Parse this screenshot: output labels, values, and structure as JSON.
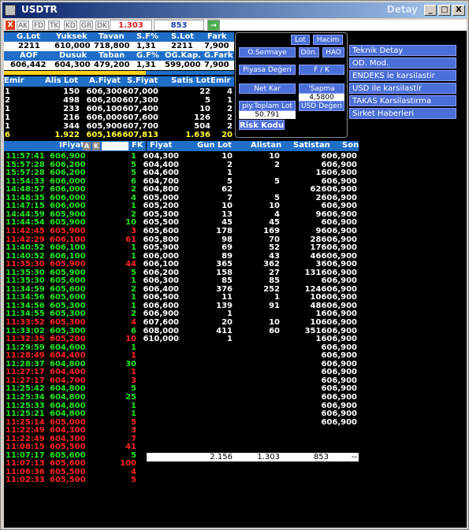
{
  "window": {
    "title": "USDTR",
    "right_title": "Detay",
    "min_label": "_",
    "max_label": "□",
    "close_label": "X"
  },
  "toolbar": {
    "close_label": "X",
    "tabs": [
      "AK",
      "FD",
      "TK",
      "KD",
      "GR",
      "DK"
    ],
    "price_red": "1.303",
    "price_blue": "853",
    "go_label": "→"
  },
  "summary": {
    "headers1": [
      "G.Lot",
      "Yuksek",
      "Tavan",
      "S.F%",
      "S.Lot",
      "Fark"
    ],
    "values1": [
      "2211",
      "610,000",
      "718,800",
      "1,31",
      "2211",
      "7,900"
    ],
    "headers2": [
      "AOF",
      "Dusuk",
      "Taban",
      "G.F%",
      "OG.Kap.",
      "G.Fark"
    ],
    "values2": [
      "606,442",
      "604,300",
      "479,200",
      "1,31",
      "599,000",
      "7,900"
    ]
  },
  "depth": {
    "headers": [
      "Emir",
      "Alis Lot",
      "A.Fiyat",
      "S.Fiyat",
      "Satis Lot",
      "Emir"
    ],
    "rows": [
      [
        "1",
        "150",
        "606,300",
        "607,000",
        "22",
        "4"
      ],
      [
        "2",
        "498",
        "606,200",
        "607,300",
        "5",
        "1"
      ],
      [
        "1",
        "233",
        "606,100",
        "607,400",
        "10",
        "2"
      ],
      [
        "1",
        "216",
        "606,000",
        "607,600",
        "126",
        "2"
      ],
      [
        "1",
        "344",
        "605,900",
        "607,700",
        "504",
        "2"
      ]
    ],
    "total": [
      "16",
      "1.922",
      "605,166",
      "607,813",
      "1.636",
      "20"
    ]
  },
  "panel": {
    "lot_label": "Lot",
    "hacim_label": "Hacim",
    "osermaye_label": "O.Sermaye",
    "don_label": "Dön.",
    "hao_label": "HAO",
    "piyasa_label": "Piyasa Değeri",
    "fk_label": "F / K",
    "netkar_label": "Net Kar",
    "sapma_label": "'Sapma",
    "sapma_value": "4,5800",
    "piy_toplam_label": "piy.Toplam Lot",
    "usd_degeri_label": "USD Değeri",
    "piy_toplam_value": "50.791",
    "risk_label": "Risk Kodu"
  },
  "side_menu": [
    "Teknik Detay",
    "OD. Mod.",
    "ENDEKS le karsilastir",
    "USD ile karsilastir",
    "TAKAS Karsilastirma",
    "Sirket Haberleri"
  ],
  "trades": {
    "header_time": "",
    "header_price": "IFiyat",
    "header_a": "A",
    "header_k": "K",
    "header_fk": "FK",
    "rows": [
      {
        "time": "11:57:41",
        "price": "606,900",
        "lot": "1",
        "side": "buy"
      },
      {
        "time": "15:57:28",
        "price": "606,200",
        "lot": "5",
        "side": "buy"
      },
      {
        "time": "15:57:28",
        "price": "606,200",
        "lot": "5",
        "side": "buy"
      },
      {
        "time": "11:54:33",
        "price": "606,000",
        "lot": "6",
        "side": "buy"
      },
      {
        "time": "14:48:57",
        "price": "606,000",
        "lot": "2",
        "side": "buy"
      },
      {
        "time": "11:48:35",
        "price": "606,000",
        "lot": "4",
        "side": "buy"
      },
      {
        "time": "11:47:15",
        "price": "606,000",
        "lot": "1",
        "side": "buy"
      },
      {
        "time": "14:44:59",
        "price": "605,900",
        "lot": "2",
        "side": "buy"
      },
      {
        "time": "11:44:54",
        "price": "605,900",
        "lot": "10",
        "side": "buy"
      },
      {
        "time": "11:42:45",
        "price": "605,900",
        "lot": "3",
        "side": "sell"
      },
      {
        "time": "11:42:29",
        "price": "606,100",
        "lot": "61",
        "side": "sell"
      },
      {
        "time": "11:40:52",
        "price": "606,100",
        "lot": "1",
        "side": "buy"
      },
      {
        "time": "11:40:52",
        "price": "606,100",
        "lot": "1",
        "side": "buy"
      },
      {
        "time": "11:35:30",
        "price": "605,900",
        "lot": "44",
        "side": "sell"
      },
      {
        "time": "11:35:30",
        "price": "605,900",
        "lot": "5",
        "side": "buy"
      },
      {
        "time": "11:35:30",
        "price": "605,600",
        "lot": "1",
        "side": "buy"
      },
      {
        "time": "11:34:59",
        "price": "605,600",
        "lot": "2",
        "side": "buy"
      },
      {
        "time": "11:34:56",
        "price": "605,600",
        "lot": "1",
        "side": "buy"
      },
      {
        "time": "11:34:56",
        "price": "605,300",
        "lot": "1",
        "side": "buy"
      },
      {
        "time": "11:34:55",
        "price": "605,300",
        "lot": "2",
        "side": "buy"
      },
      {
        "time": "11:33:52",
        "price": "605,300",
        "lot": "4",
        "side": "sell"
      },
      {
        "time": "11:33:02",
        "price": "605,300",
        "lot": "6",
        "side": "buy"
      },
      {
        "time": "11:32:35",
        "price": "605,200",
        "lot": "10",
        "side": "sell"
      },
      {
        "time": "11:29:59",
        "price": "604,600",
        "lot": "1",
        "side": "buy"
      },
      {
        "time": "11:28:49",
        "price": "604,400",
        "lot": "1",
        "side": "sell"
      },
      {
        "time": "11:28:37",
        "price": "604,800",
        "lot": "30",
        "side": "buy"
      },
      {
        "time": "11:27:17",
        "price": "604,400",
        "lot": "1",
        "side": "sell"
      },
      {
        "time": "11:27:17",
        "price": "604,700",
        "lot": "3",
        "side": "sell"
      },
      {
        "time": "11:25:42",
        "price": "604,800",
        "lot": "5",
        "side": "buy"
      },
      {
        "time": "11:25:34",
        "price": "604,800",
        "lot": "25",
        "side": "buy"
      },
      {
        "time": "11:25:33",
        "price": "604,800",
        "lot": "1",
        "side": "buy"
      },
      {
        "time": "11:25:21",
        "price": "604,800",
        "lot": "1",
        "side": "buy"
      },
      {
        "time": "11:25:14",
        "price": "605,000",
        "lot": "5",
        "side": "sell"
      },
      {
        "time": "11:22:49",
        "price": "604,300",
        "lot": "3",
        "side": "sell"
      },
      {
        "time": "11:22:49",
        "price": "604,300",
        "lot": "7",
        "side": "sell"
      },
      {
        "time": "11:08:15",
        "price": "605,500",
        "lot": "41",
        "side": "sell"
      },
      {
        "time": "11:07:17",
        "price": "605,600",
        "lot": "5",
        "side": "buy"
      },
      {
        "time": "11:07:13",
        "price": "605,600",
        "lot": "100",
        "side": "sell"
      },
      {
        "time": "11:06:36",
        "price": "605,500",
        "lot": "4",
        "side": "sell"
      },
      {
        "time": "11:02:33",
        "price": "605,500",
        "lot": "5",
        "side": "sell"
      }
    ]
  },
  "volume": {
    "headers": [
      "Fiyat",
      "Gun Lot",
      "Alistan",
      "Satistan",
      "Son"
    ],
    "rows": [
      [
        "604,300",
        "10",
        "10",
        "",
        "606,900"
      ],
      [
        "604,400",
        "2",
        "2",
        "",
        "606,900"
      ],
      [
        "604,600",
        "1",
        "",
        "",
        "1606,900"
      ],
      [
        "604,700",
        "5",
        "5",
        "",
        "606,900"
      ],
      [
        "604,800",
        "62",
        "",
        "",
        "62606,900"
      ],
      [
        "605,000",
        "7",
        "5",
        "",
        "2606,900"
      ],
      [
        "605,200",
        "10",
        "10",
        "",
        "606,900"
      ],
      [
        "605,300",
        "13",
        "4",
        "",
        "9606,900"
      ],
      [
        "605,500",
        "45",
        "45",
        "",
        "606,900"
      ],
      [
        "605,600",
        "178",
        "169",
        "",
        "9606,900"
      ],
      [
        "605,800",
        "98",
        "70",
        "",
        "28606,900"
      ],
      [
        "605,900",
        "69",
        "52",
        "",
        "17606,900"
      ],
      [
        "606,000",
        "89",
        "43",
        "",
        "46606,900"
      ],
      [
        "606,100",
        "365",
        "362",
        "",
        "3606,900"
      ],
      [
        "606,200",
        "158",
        "27",
        "",
        "131606,900"
      ],
      [
        "606,300",
        "85",
        "85",
        "",
        "606,900"
      ],
      [
        "606,400",
        "376",
        "252",
        "",
        "124606,900"
      ],
      [
        "606,500",
        "11",
        "1",
        "",
        "10606,900"
      ],
      [
        "606,600",
        "139",
        "91",
        "",
        "48606,900"
      ],
      [
        "606,900",
        "1",
        "",
        "",
        "1606,900"
      ],
      [
        "607,600",
        "20",
        "10",
        "",
        "10606,900"
      ],
      [
        "608,000",
        "411",
        "60",
        "",
        "351606,900"
      ],
      [
        "610,000",
        "1",
        "",
        "",
        "1606,900"
      ],
      [
        "",
        "",
        "",
        "",
        "606,900"
      ],
      [
        "",
        "",
        "",
        "",
        "606,900"
      ],
      [
        "",
        "",
        "",
        "",
        "606,900"
      ],
      [
        "",
        "",
        "",
        "",
        "606,900"
      ],
      [
        "",
        "",
        "",
        "",
        "606,900"
      ],
      [
        "",
        "",
        "",
        "",
        "606,900"
      ],
      [
        "",
        "",
        "",
        "",
        "606,900"
      ],
      [
        "",
        "",
        "",
        "",
        "606,900"
      ],
      [
        "",
        "",
        "",
        "",
        "606,900"
      ],
      [
        "",
        "",
        "",
        "",
        "606,900"
      ]
    ],
    "total": [
      "",
      "2.156",
      "1.303",
      "853",
      "--"
    ]
  },
  "colors": {
    "header_blue": "#1f6ec8",
    "button_blue": "#4b6fd8",
    "buy_green": "#1ee81e",
    "sell_red": "#ff2222",
    "total_yellow": "#ffff33"
  }
}
